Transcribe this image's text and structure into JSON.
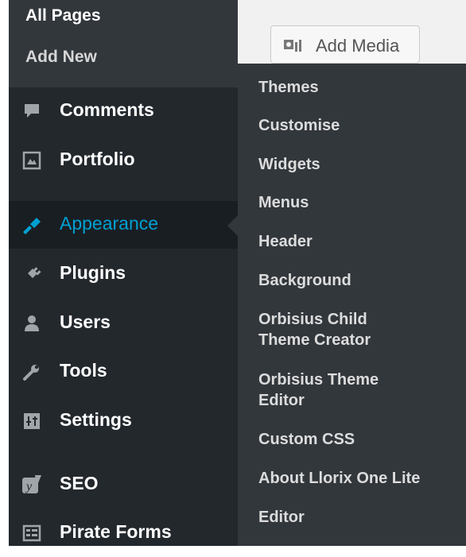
{
  "submenu_top": {
    "items": [
      {
        "label": "All Pages",
        "current": true
      },
      {
        "label": "Add New",
        "current": false
      }
    ]
  },
  "menu": {
    "items": [
      {
        "label": "Comments",
        "icon": "comment-icon"
      },
      {
        "label": "Portfolio",
        "icon": "portfolio-icon"
      },
      {
        "label": "Appearance",
        "icon": "paintbrush-icon",
        "active": true
      },
      {
        "label": "Plugins",
        "icon": "plugin-icon"
      },
      {
        "label": "Users",
        "icon": "user-icon"
      },
      {
        "label": "Tools",
        "icon": "wrench-icon"
      },
      {
        "label": "Settings",
        "icon": "settings-icon"
      },
      {
        "label": "SEO",
        "icon": "yoast-icon"
      },
      {
        "label": "Pirate Forms",
        "icon": "form-icon"
      }
    ]
  },
  "flyout": {
    "items": [
      "Themes",
      "Customise",
      "Widgets",
      "Menus",
      "Header",
      "Background",
      "Orbisius Child Theme Creator",
      "Orbisius Theme Editor",
      "Custom CSS",
      "About Llorix One Lite",
      "Editor"
    ]
  },
  "editor": {
    "add_media_label": "Add Media"
  },
  "colors": {
    "sidebar_bg": "#23282d",
    "submenu_bg": "#32373c",
    "active_bg": "#191e23",
    "accent": "#00a0d2"
  }
}
